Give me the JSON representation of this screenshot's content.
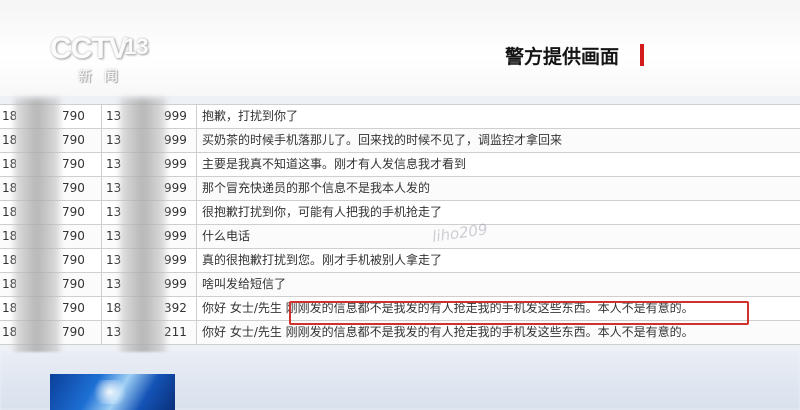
{
  "broadcast": {
    "logo_text": "CCTV",
    "channel_number": "13",
    "channel_sub": "新闻",
    "caption": "警方提供画面"
  },
  "watermark": "liho209",
  "rows": [
    {
      "c1a": "18",
      "c1b": "790",
      "c2a": "13",
      "c2b": "999",
      "message": "抱歉，打扰到你了"
    },
    {
      "c1a": "18",
      "c1b": "790",
      "c2a": "13",
      "c2b": "999",
      "message": "买奶茶的时候手机落那儿了。回来找的时候不见了，调监控才拿回来"
    },
    {
      "c1a": "18",
      "c1b": "790",
      "c2a": "13",
      "c2b": "999",
      "message": "主要是我真不知道这事。刚才有人发信息我才看到"
    },
    {
      "c1a": "18",
      "c1b": "790",
      "c2a": "13",
      "c2b": "999",
      "message": "那个冒充快递员的那个信息不是我本人发的"
    },
    {
      "c1a": "18",
      "c1b": "790",
      "c2a": "13",
      "c2b": "999",
      "message": "很抱歉打扰到你，可能有人把我的手机抢走了"
    },
    {
      "c1a": "18",
      "c1b": "790",
      "c2a": "13",
      "c2b": "999",
      "message": "什么电话"
    },
    {
      "c1a": "18",
      "c1b": "790",
      "c2a": "13",
      "c2b": "999",
      "message": "真的很抱歉打扰到您。刚才手机被别人拿走了"
    },
    {
      "c1a": "18",
      "c1b": "790",
      "c2a": "13",
      "c2b": "999",
      "message": "啥叫发给短信了"
    },
    {
      "c1a": "18",
      "c1b": "790",
      "c2a": "18",
      "c2b": "392",
      "message": "你好 女士/先生 刚刚发的信息都不是我发的有人抢走我的手机发这些东西。本人不是有意的。"
    },
    {
      "c1a": "18",
      "c1b": "790",
      "c2a": "13",
      "c2b": "211",
      "message": "你好 女士/先生 刚刚发的信息都不是我发的有人抢走我的手机发这些东西。本人不是有意的。"
    }
  ]
}
